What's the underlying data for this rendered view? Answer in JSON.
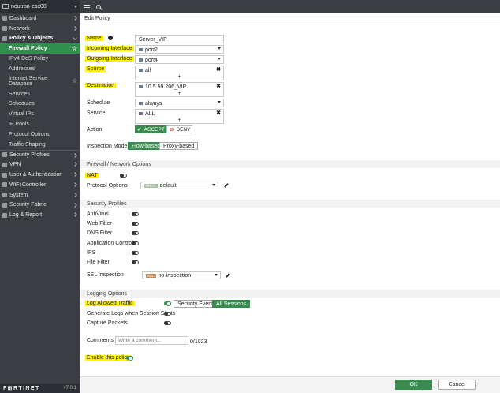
{
  "device": "neutron-esx08",
  "version": "v7.0.1",
  "brand": "F⊞RTINET",
  "sidebar": {
    "items": [
      {
        "label": "Dashboard",
        "icon": "dashboard-icon"
      },
      {
        "label": "Network",
        "icon": "network-icon"
      },
      {
        "label": "Policy & Objects",
        "icon": "policy-icon"
      }
    ],
    "policy_sub": [
      {
        "label": "Firewall Policy",
        "active": true
      },
      {
        "label": "IPv4 DoS Policy"
      },
      {
        "label": "Addresses"
      },
      {
        "label": "Internet Service Database"
      },
      {
        "label": "Services"
      },
      {
        "label": "Schedules"
      },
      {
        "label": "Virtual IPs"
      },
      {
        "label": "IP Pools"
      },
      {
        "label": "Protocol Options"
      },
      {
        "label": "Traffic Shaping"
      }
    ],
    "lower": [
      {
        "label": "Security Profiles",
        "icon": "security-profiles-icon"
      },
      {
        "label": "VPN",
        "icon": "vpn-icon"
      },
      {
        "label": "User & Authentication",
        "icon": "user-icon"
      },
      {
        "label": "WiFi Controller",
        "icon": "wifi-icon"
      },
      {
        "label": "System",
        "icon": "system-icon"
      },
      {
        "label": "Security Fabric",
        "icon": "security-fabric-icon"
      },
      {
        "label": "Log & Report",
        "icon": "log-report-icon"
      }
    ]
  },
  "page_title": "Edit Policy",
  "form": {
    "name_label": "Name",
    "name_value": "Server_VIP",
    "incoming_label": "Incoming Interface",
    "incoming_value": "port2",
    "outgoing_label": "Outgoing Interface",
    "outgoing_value": "port4",
    "source_label": "Source",
    "source_value": "all",
    "destination_label": "Destination",
    "destination_value": "10.5.59.206_VIP",
    "schedule_label": "Schedule",
    "schedule_value": "always",
    "service_label": "Service",
    "service_value": "ALL",
    "action_label": "Action",
    "accept_label": "ACCEPT",
    "deny_label": "DENY",
    "inspection_label": "Inspection Mode",
    "flow_label": "Flow-based",
    "proxy_label": "Proxy-based",
    "plus": "+",
    "close": "✖"
  },
  "firewall_section": {
    "title": "Firewall / Network Options",
    "nat_label": "NAT",
    "protocol_label": "Protocol Options",
    "protocol_badge": "PROT",
    "protocol_value": "default"
  },
  "security_profiles": {
    "title": "Security Profiles",
    "items": [
      "AntiVirus",
      "Web Filter",
      "DNS Filter",
      "Application Control",
      "IPS",
      "File Filter"
    ],
    "ssl_label": "SSL Inspection",
    "ssl_badge": "SSL",
    "ssl_value": "no-inspection"
  },
  "logging": {
    "title": "Logging Options",
    "log_allowed_label": "Log Allowed Traffic",
    "security_events": "Security Events",
    "all_sessions": "All Sessions",
    "generate_logs_label": "Generate Logs when Session Starts",
    "capture_label": "Capture Packets",
    "comments_label": "Comments",
    "comments_placeholder": "Write a comment...",
    "counter": "0/1023",
    "enable_label": "Enable this policy"
  },
  "buttons": {
    "ok": "OK",
    "cancel": "Cancel"
  },
  "colors": {
    "highlight": "#fff200",
    "accent": "#2f8f4d",
    "sidebar": "#3a3d42"
  }
}
